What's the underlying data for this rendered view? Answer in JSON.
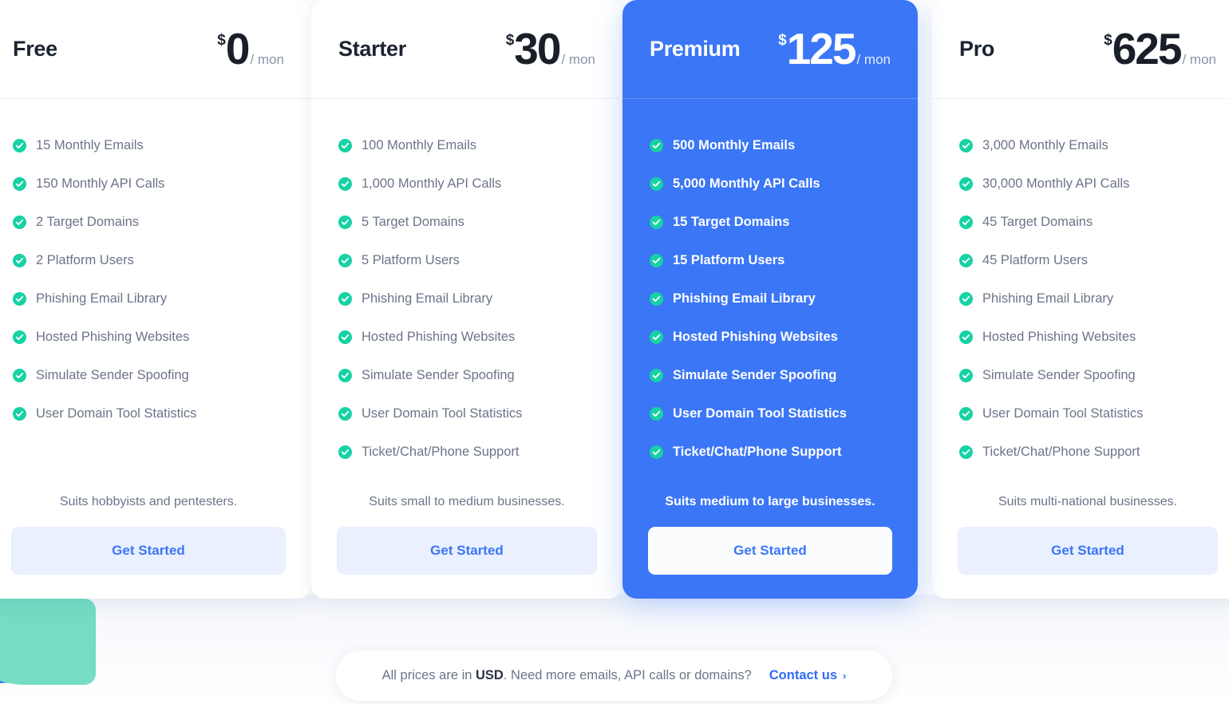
{
  "colors": {
    "accent_blue": "#3b76f6",
    "check_green": "#16d2a4",
    "cta_bg": "#eaf0fe",
    "mint_shape": "#74ddc3",
    "text_muted": "#6b7489"
  },
  "currency_symbol": "$",
  "period_label": "/ mon",
  "cta_label": "Get Started",
  "plans": [
    {
      "name": "Free",
      "price": "0",
      "tagline": "Suits hobbyists and pentesters.",
      "highlighted": false,
      "features": [
        "15 Monthly Emails",
        "150 Monthly API Calls",
        "2 Target Domains",
        "2 Platform Users",
        "Phishing Email Library",
        "Hosted Phishing Websites",
        "Simulate Sender Spoofing",
        "User Domain Tool Statistics"
      ]
    },
    {
      "name": "Starter",
      "price": "30",
      "tagline": "Suits small to medium businesses.",
      "highlighted": false,
      "features": [
        "100 Monthly Emails",
        "1,000 Monthly API Calls",
        "5 Target Domains",
        "5 Platform Users",
        "Phishing Email Library",
        "Hosted Phishing Websites",
        "Simulate Sender Spoofing",
        "User Domain Tool Statistics",
        "Ticket/Chat/Phone Support"
      ]
    },
    {
      "name": "Premium",
      "price": "125",
      "tagline": "Suits medium to large businesses.",
      "highlighted": true,
      "features": [
        "500 Monthly Emails",
        "5,000 Monthly API Calls",
        "15 Target Domains",
        "15 Platform Users",
        "Phishing Email Library",
        "Hosted Phishing Websites",
        "Simulate Sender Spoofing",
        "User Domain Tool Statistics",
        "Ticket/Chat/Phone Support"
      ]
    },
    {
      "name": "Pro",
      "price": "625",
      "tagline": "Suits multi-national businesses.",
      "highlighted": false,
      "features": [
        "3,000 Monthly Emails",
        "30,000 Monthly API Calls",
        "45 Target Domains",
        "45 Platform Users",
        "Phishing Email Library",
        "Hosted Phishing Websites",
        "Simulate Sender Spoofing",
        "User Domain Tool Statistics",
        "Ticket/Chat/Phone Support"
      ]
    }
  ],
  "note": {
    "prefix": "All prices are in ",
    "strong": "USD",
    "suffix": ". Need more emails, API calls or domains?",
    "link_label": "Contact us",
    "chevron": "›"
  }
}
